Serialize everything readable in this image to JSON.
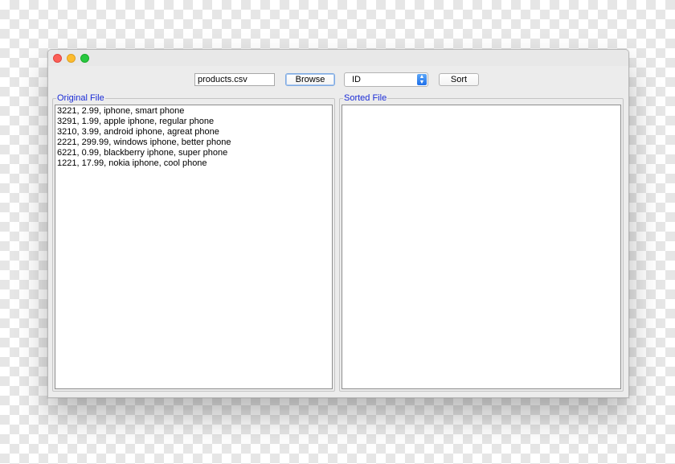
{
  "toolbar": {
    "file_path": "products.csv",
    "browse_label": "Browse",
    "sort_field": "ID",
    "sort_label": "Sort"
  },
  "original_panel": {
    "title": "Original File",
    "lines": [
      "3221, 2.99, iphone, smart phone",
      "3291, 1.99, apple iphone, regular phone",
      "3210, 3.99, android iphone, agreat phone",
      "2221, 299.99, windows iphone, better phone",
      "6221, 0.99, blackberry iphone, super phone",
      "1221, 17.99, nokia iphone, cool phone"
    ]
  },
  "sorted_panel": {
    "title": "Sorted File",
    "lines": []
  },
  "colors": {
    "panel_title": "#1a2bd6",
    "close": "#fc5f57",
    "minimize": "#fdbc2e",
    "maximize": "#28c840"
  },
  "icons": {
    "combo_arrow": "chevron-up-down-icon"
  }
}
